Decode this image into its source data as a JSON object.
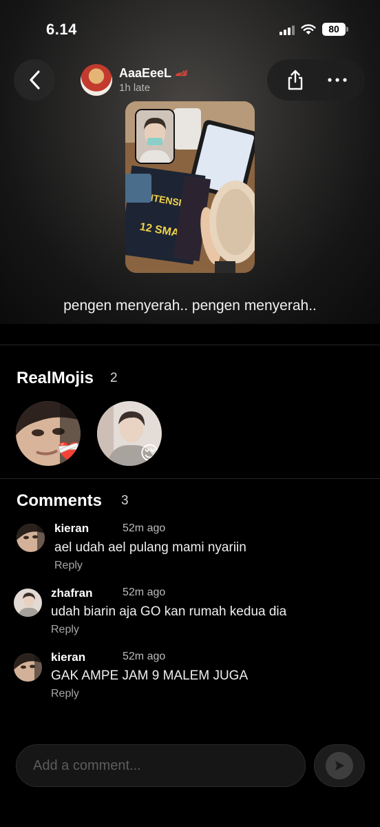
{
  "status_bar": {
    "time": "6.14",
    "battery": "80"
  },
  "post": {
    "username": "AaaEeeL",
    "late_label": "1h late",
    "caption": "pengen menyerah.. pengen menyerah.."
  },
  "realmojis": {
    "title": "RealMojis",
    "count": "2",
    "items": [
      {
        "reaction": "❤️‍🩹",
        "icon": "mending-heart-icon"
      },
      {
        "reaction": "😌",
        "icon": "relieved-face-icon"
      }
    ]
  },
  "comments": {
    "title": "Comments",
    "count": "3",
    "items": [
      {
        "user": "kieran",
        "time": "52m ago",
        "text": "ael udah ael pulang mami nyariin",
        "reply": "Reply"
      },
      {
        "user": "zhafran",
        "time": "52m ago",
        "text": "udah biarin aja GO kan rumah kedua dia",
        "reply": "Reply"
      },
      {
        "user": "kieran",
        "time": "52m ago",
        "text": "GAK AMPE JAM 9 MALEM JUGA",
        "reply": "Reply"
      }
    ]
  },
  "composer": {
    "placeholder": "Add a comment..."
  }
}
